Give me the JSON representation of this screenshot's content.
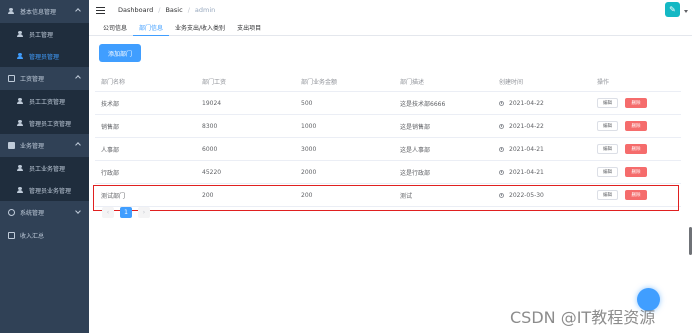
{
  "sidebar": {
    "groups": [
      {
        "label": "基本信息管理",
        "items": [
          "员工管理",
          "管理员管理"
        ]
      },
      {
        "label": "工资管理",
        "items": [
          "员工工资管理",
          "管理员工资管理"
        ]
      },
      {
        "label": "业务管理",
        "items": [
          "员工业务管理",
          "管理员业务管理"
        ]
      },
      {
        "label": "系统管理"
      },
      {
        "label": "收入汇总"
      }
    ],
    "active_item": "管理员管理"
  },
  "header": {
    "breadcrumb": [
      "Dashboard",
      "Basic",
      "admin"
    ],
    "avatar_glyph": "✎"
  },
  "tabs": [
    "公司信息",
    "部门信息",
    "业务支出/收入类别",
    "支出项目"
  ],
  "active_tab": "部门信息",
  "toolbar": {
    "add_label": "添加部门"
  },
  "table": {
    "headers": [
      "部门名称",
      "部门工资",
      "部门业务金额",
      "部门描述",
      "创建时间",
      "操作"
    ],
    "rows": [
      {
        "name": "技术部",
        "salary": "19024",
        "amount": "500",
        "desc": "这是技术部6666",
        "date": "2021-04-22"
      },
      {
        "name": "销售部",
        "salary": "8300",
        "amount": "1000",
        "desc": "这是销售部",
        "date": "2021-04-22"
      },
      {
        "name": "人事部",
        "salary": "6000",
        "amount": "3000",
        "desc": "这是人事部",
        "date": "2021-04-21"
      },
      {
        "name": "行政部",
        "salary": "45220",
        "amount": "2000",
        "desc": "这是行政部",
        "date": "2021-04-21"
      },
      {
        "name": "测试部门",
        "salary": "200",
        "amount": "200",
        "desc": "测试",
        "date": "2022-05-30"
      }
    ],
    "edit_label": "编辑",
    "delete_label": "删除"
  },
  "pagination": {
    "prev": "‹",
    "page": "1",
    "next": "›"
  },
  "watermark": "CSDN @IT教程资源",
  "colors": {
    "sidebar_bg": "#304156",
    "submenu_bg": "#1f2d3d",
    "primary": "#409eff",
    "danger": "#f56c6c",
    "highlight": "#e02020"
  }
}
